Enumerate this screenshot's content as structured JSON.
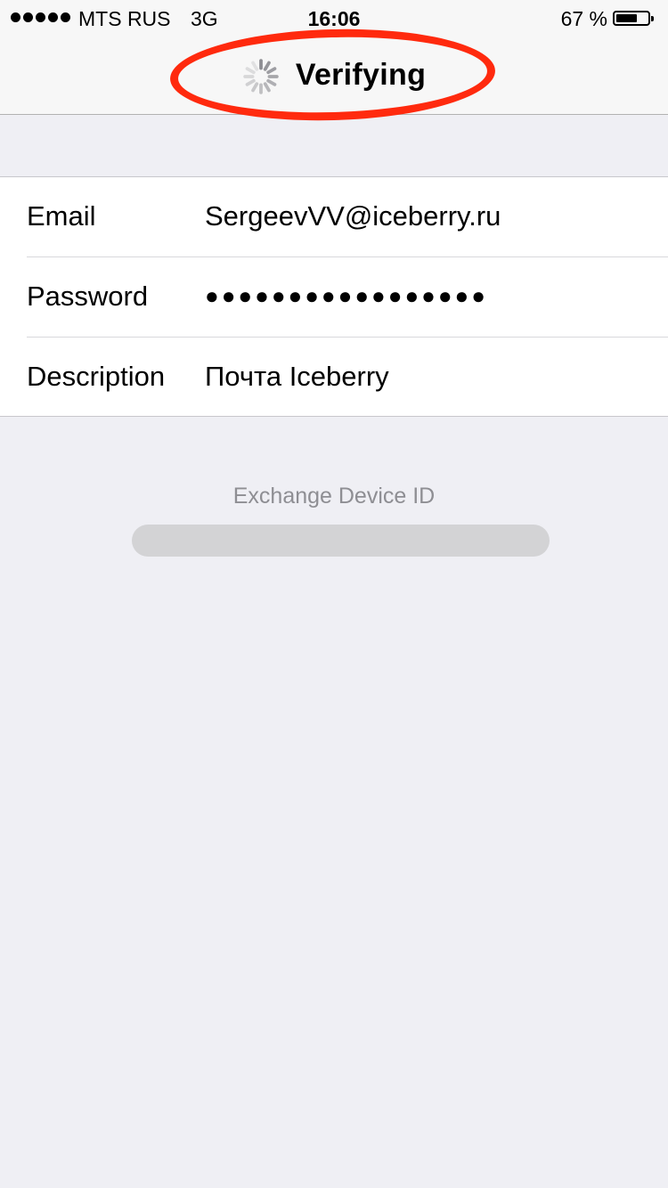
{
  "status_bar": {
    "carrier": "MTS RUS",
    "network": "3G",
    "time": "16:06",
    "battery_percent": "67 %",
    "battery_level": 0.67,
    "signal_bars": 5
  },
  "nav": {
    "title": "Verifying",
    "spinner_icon": "activity-spinner-icon",
    "annotation_color": "#ff2a0e"
  },
  "form": {
    "rows": [
      {
        "label": "Email",
        "value": "SergeevVV@iceberry.ru"
      },
      {
        "label": "Password",
        "value": "●●●●●●●●●●●●●●●●●"
      },
      {
        "label": "Description",
        "value": "Почта Iceberry"
      }
    ]
  },
  "footer": {
    "title": "Exchange Device ID"
  }
}
